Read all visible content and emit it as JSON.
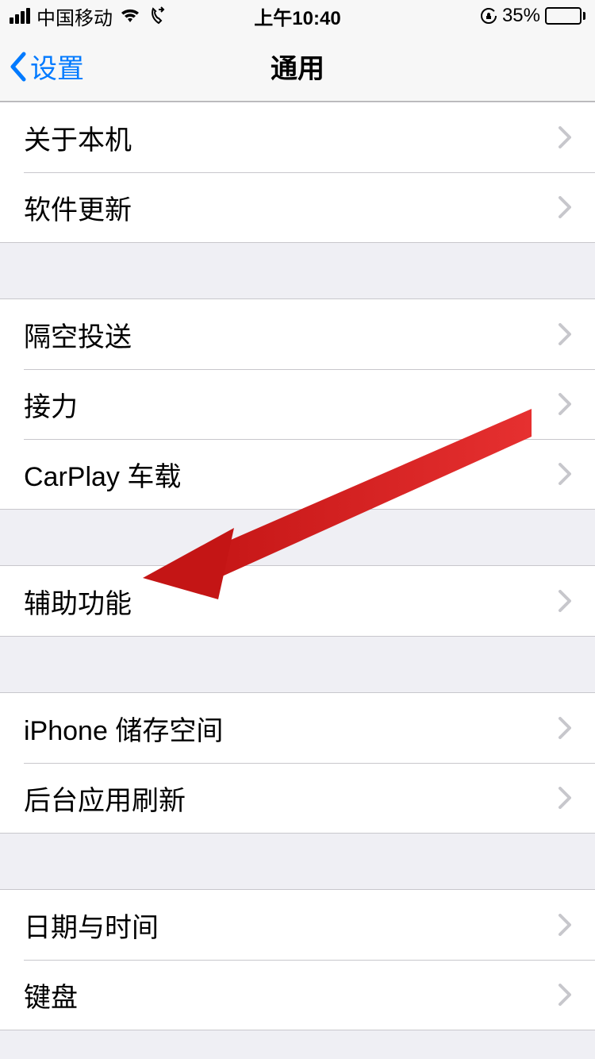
{
  "status_bar": {
    "carrier": "中国移动",
    "time": "上午10:40",
    "battery_percent": "35%"
  },
  "nav": {
    "back_label": "设置",
    "title": "通用"
  },
  "sections": [
    {
      "rows": [
        {
          "label": "关于本机"
        },
        {
          "label": "软件更新"
        }
      ]
    },
    {
      "rows": [
        {
          "label": "隔空投送"
        },
        {
          "label": "接力"
        },
        {
          "label": "CarPlay 车载"
        }
      ]
    },
    {
      "rows": [
        {
          "label": "辅助功能"
        }
      ]
    },
    {
      "rows": [
        {
          "label": "iPhone 储存空间"
        },
        {
          "label": "后台应用刷新"
        }
      ]
    },
    {
      "rows": [
        {
          "label": "日期与时间"
        },
        {
          "label": "键盘"
        }
      ]
    }
  ]
}
